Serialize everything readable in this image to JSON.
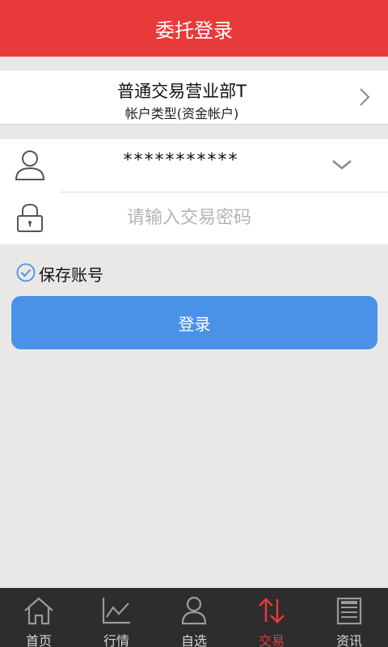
{
  "header": {
    "title": "委托登录"
  },
  "branch": {
    "name": "普通交易营业部T",
    "type": "帐户类型(资金帐户)"
  },
  "form": {
    "account_value": "***********",
    "password_placeholder": "请输入交易密码"
  },
  "save_account": {
    "label": "保存账号",
    "checked": true
  },
  "login_button": {
    "label": "登录"
  },
  "tabbar": {
    "active": "交易",
    "items": [
      {
        "label": "首页",
        "icon": "home-icon"
      },
      {
        "label": "行情",
        "icon": "chart-icon"
      },
      {
        "label": "自选",
        "icon": "user-icon"
      },
      {
        "label": "交易",
        "icon": "trade-arrows-icon"
      },
      {
        "label": "资讯",
        "icon": "news-icon"
      }
    ]
  },
  "colors": {
    "accent_red": "#e83a3a",
    "button_blue": "#4a92e8",
    "tabbar_bg": "#2d2d2d",
    "page_bg": "#e9e8e6"
  }
}
